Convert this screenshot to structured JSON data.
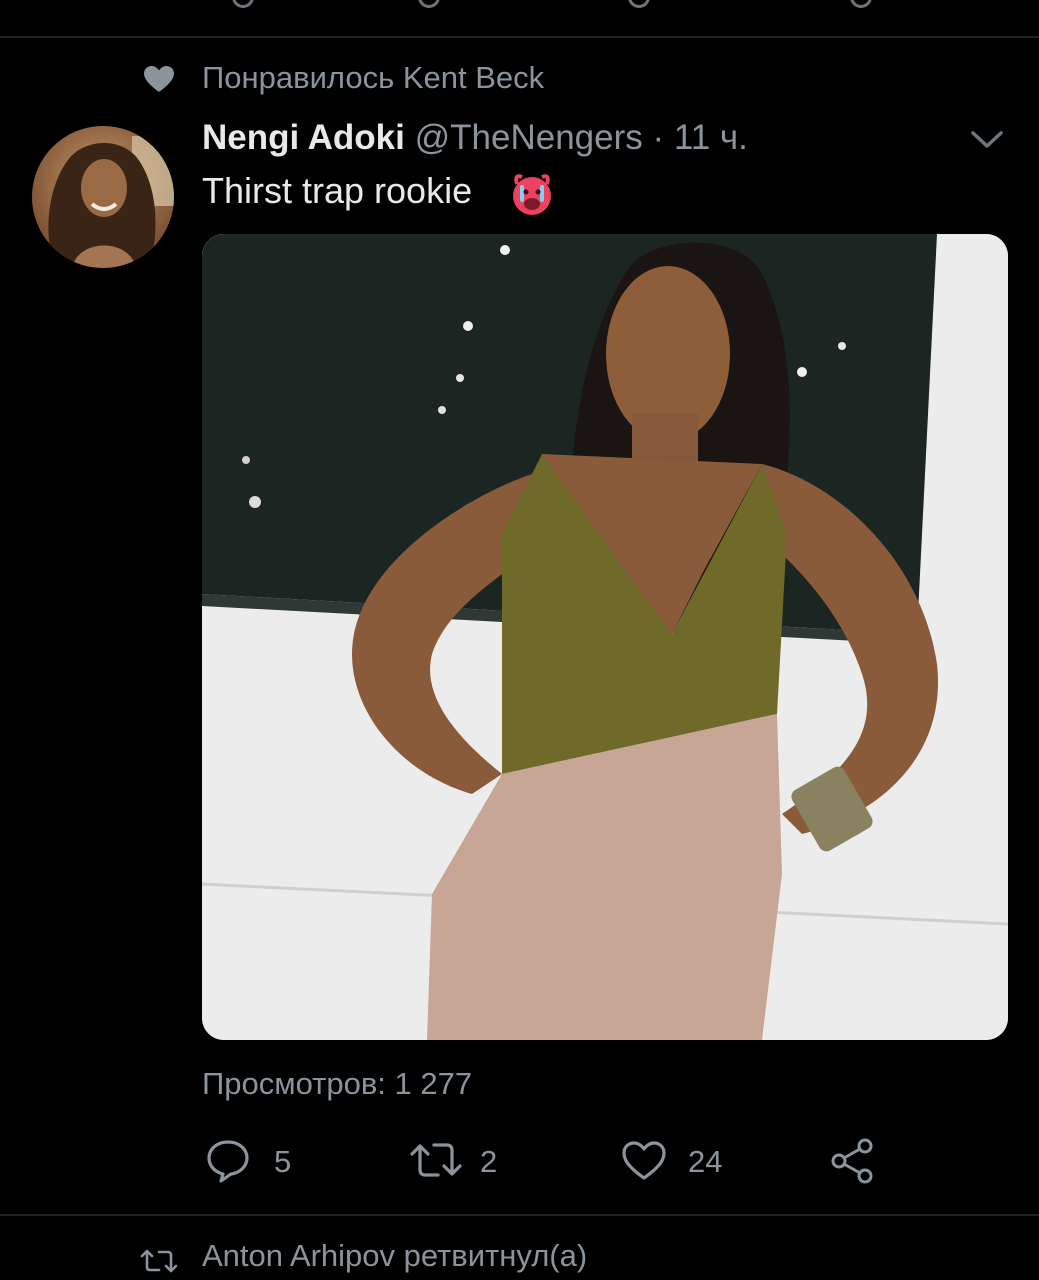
{
  "liked_context": {
    "text": "Понравилось Kent Beck",
    "icon": "heart-icon"
  },
  "tweet": {
    "author_name": "Nengi Adoki",
    "handle": "@TheNengers",
    "separator": "·",
    "time": "11 ч.",
    "text": "Thirst trap rookie",
    "emoji": "hot-face-emoji",
    "views": "Просмотров: 1 277"
  },
  "actions": {
    "reply_count": "5",
    "retweet_count": "2",
    "like_count": "24"
  },
  "next_context": {
    "text": "Anton Arhipov ретвитнул(а)",
    "icon": "retweet-icon"
  },
  "colors": {
    "background": "#000000",
    "text_primary": "#e7e9ea",
    "text_secondary": "#8b949c",
    "divider": "#1f2226"
  }
}
